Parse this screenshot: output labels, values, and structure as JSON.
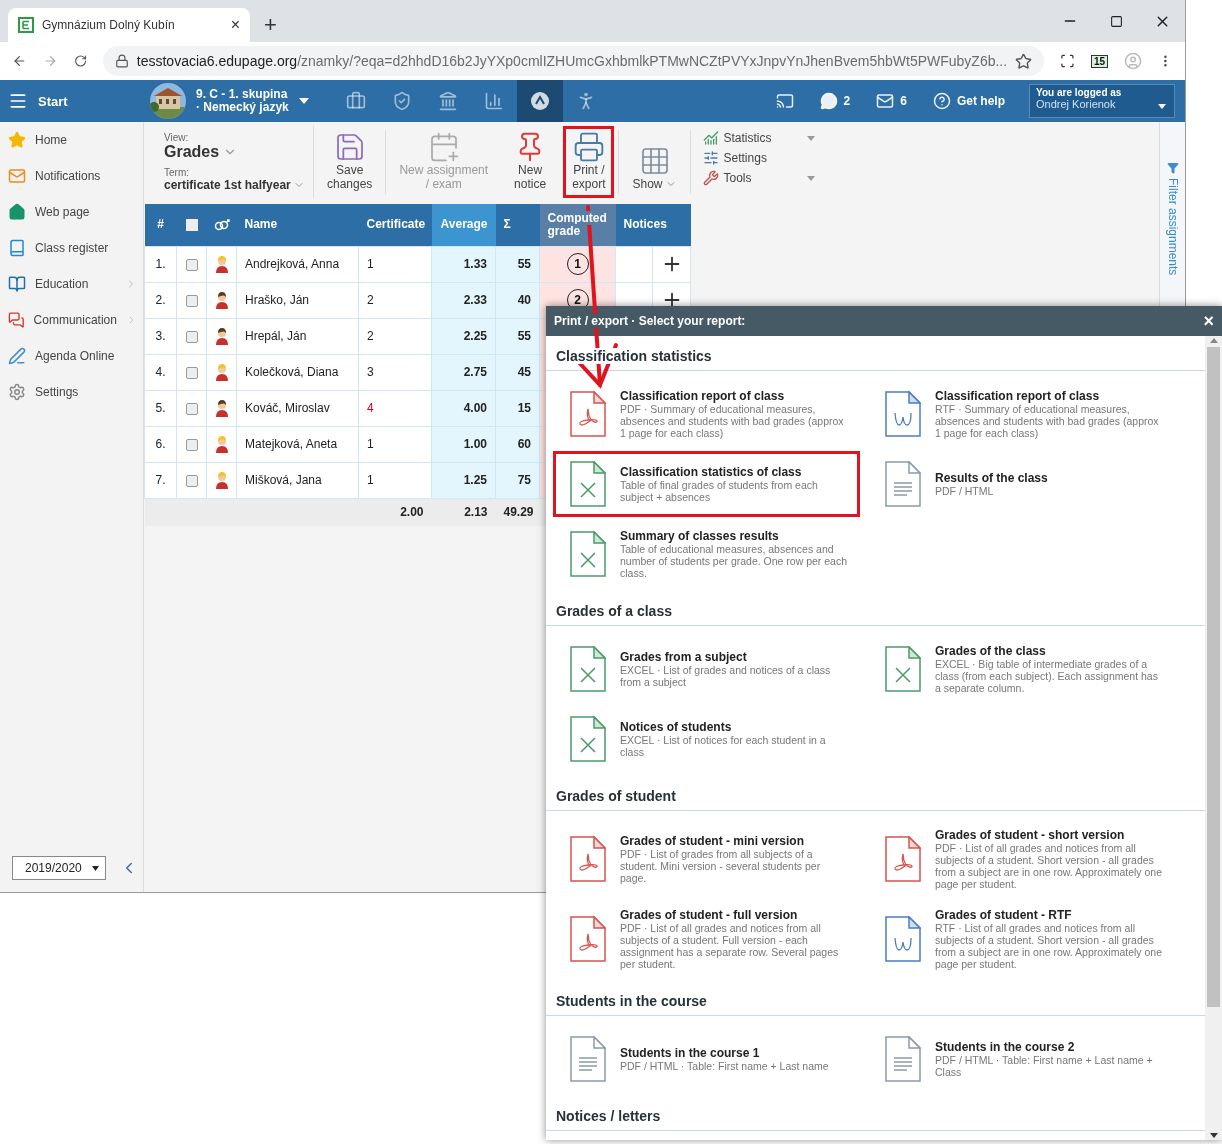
{
  "browser": {
    "tab_title": "Gymnázium Dolný Kubín",
    "tab_close": "×",
    "new_tab": "+",
    "url_domain": "tesstovacia6.edupage.org",
    "url_path": "/znamky/?eqa=d2hhdD16b2JyYXp0cmlIZHUmcGxhbmlkPTMwNCZtPVYxJnpvYnJhenBvem5hbWt5PWFubyZ6b...",
    "calendar_badge": "15"
  },
  "topbar": {
    "start": "Start",
    "class_line1": "9. C - 1. skupina",
    "class_line2": "· Nemecký jazyk",
    "nav": [
      {
        "kind": "briefcase",
        "selected": false
      },
      {
        "kind": "shield",
        "selected": false
      },
      {
        "kind": "bank",
        "selected": false
      },
      {
        "kind": "chart",
        "selected": false
      },
      {
        "kind": "grades",
        "selected": true
      },
      {
        "kind": "walk",
        "selected": false
      }
    ],
    "messages_count": "2",
    "mail_count": "6",
    "help": "Get help",
    "logged_label": "You are logged as",
    "user": "Ondrej Korienok"
  },
  "sidebar": {
    "items": [
      {
        "kind": "home",
        "label": "Home",
        "has_submenu": false
      },
      {
        "kind": "notifications",
        "label": "Notifications",
        "has_submenu": false
      },
      {
        "kind": "web",
        "label": "Web page",
        "has_submenu": false
      },
      {
        "kind": "register",
        "label": "Class register",
        "has_submenu": false
      },
      {
        "kind": "education",
        "label": "Education",
        "has_submenu": true
      },
      {
        "kind": "communication",
        "label": "Communication",
        "has_submenu": true
      },
      {
        "kind": "agenda",
        "label": "Agenda Online",
        "has_submenu": false
      },
      {
        "kind": "settings",
        "label": "Settings",
        "has_submenu": false
      }
    ],
    "year": "2019/2020"
  },
  "toolbar": {
    "view_label": "View:",
    "view_value": "Grades",
    "term_label": "Term:",
    "term_value": "certificate 1st halfyear",
    "buttons": [
      {
        "kind": "save",
        "lines": [
          "Save",
          "changes"
        ],
        "disabled": false,
        "highlighted": false,
        "has_dropdown": false
      },
      {
        "kind": "assignment",
        "lines": [
          "New assignment",
          "/ exam"
        ],
        "disabled": true,
        "highlighted": false,
        "has_dropdown": false
      },
      {
        "kind": "notice",
        "lines": [
          "New",
          "notice"
        ],
        "disabled": false,
        "highlighted": false,
        "has_dropdown": false
      },
      {
        "kind": "print",
        "lines": [
          "Print /",
          "export"
        ],
        "disabled": false,
        "highlighted": true,
        "has_dropdown": false
      },
      {
        "kind": "show",
        "lines": [
          "Show"
        ],
        "disabled": false,
        "highlighted": false,
        "has_dropdown": true
      }
    ],
    "menu": [
      {
        "kind": "statistics",
        "label": "Statistics",
        "has_dropdown": true
      },
      {
        "kind": "settings",
        "label": "Settings",
        "has_dropdown": false
      },
      {
        "kind": "tools",
        "label": "Tools",
        "has_dropdown": true
      }
    ]
  },
  "table": {
    "select_all_checked": false,
    "columns": [
      {
        "kind": "number",
        "label": "#"
      },
      {
        "kind": "select"
      },
      {
        "kind": "gender"
      },
      {
        "kind": "name",
        "label": "Name"
      },
      {
        "kind": "certificate",
        "label": "Certificate"
      },
      {
        "kind": "average",
        "label": "Average"
      },
      {
        "kind": "sum",
        "label": "Σ"
      },
      {
        "kind": "computed",
        "label": "Computed grade"
      },
      {
        "kind": "notices",
        "label": "Notices"
      }
    ],
    "rows": [
      {
        "number": "1.",
        "checked": false,
        "kind": "female",
        "name": "Andrejková, Anna",
        "certificate": "1",
        "failing": false,
        "average": "1.33",
        "sum": "55",
        "computed_grade": "1"
      },
      {
        "number": "2.",
        "checked": false,
        "kind": "male",
        "name": "Hraško, Ján",
        "certificate": "2",
        "failing": false,
        "average": "2.33",
        "sum": "40",
        "computed_grade": "2"
      },
      {
        "number": "3.",
        "checked": false,
        "kind": "male",
        "name": "Hrepál, Ján",
        "certificate": "2",
        "failing": false,
        "average": "2.25",
        "sum": "55"
      },
      {
        "number": "4.",
        "checked": false,
        "kind": "female",
        "name": "Kolečková, Diana",
        "certificate": "3",
        "failing": false,
        "average": "2.75",
        "sum": "45"
      },
      {
        "number": "5.",
        "checked": false,
        "kind": "male",
        "name": "Kováč, Miroslav",
        "certificate": "4",
        "failing": true,
        "average": "4.00",
        "sum": "15"
      },
      {
        "number": "6.",
        "checked": false,
        "kind": "female",
        "name": "Matejková, Aneta",
        "certificate": "1",
        "failing": false,
        "average": "1.00",
        "sum": "60"
      },
      {
        "number": "7.",
        "checked": false,
        "kind": "female",
        "name": "Mišková, Jana",
        "certificate": "1",
        "failing": false,
        "average": "1.25",
        "sum": "75"
      }
    ],
    "footer": {
      "certificate": "2.00",
      "average": "2.13",
      "sum": "49.29"
    }
  },
  "filter_panel": {
    "label": "Filter assignments"
  },
  "dialog": {
    "title": "Print / export · Select your report:",
    "close": "×",
    "sections": [
      {
        "title": "Classification statistics",
        "items": [
          {
            "kind": "pdf",
            "title": "Classification report of class",
            "description": "PDF · Summary of educational measures, absences and students with bad grades (approx 1 page for each class)",
            "highlighted": false
          },
          {
            "kind": "rtf",
            "title": "Classification report of class",
            "description": "RTF · Summary of educational measures, absences and students with bad grades (approx 1 page for each class)",
            "highlighted": false
          },
          {
            "kind": "excel",
            "title": "Classification statistics of class",
            "description": "Table of final grades of students from each subject + absences",
            "highlighted": true
          },
          {
            "kind": "doc",
            "title": "Results of the class",
            "description": "PDF / HTML",
            "highlighted": false
          },
          {
            "kind": "excel",
            "title": "Summary of classes results",
            "description": "Table of educational measures, absences and number of students per grade. One row per each class.",
            "highlighted": false
          }
        ]
      },
      {
        "title": "Grades of a class",
        "items": [
          {
            "kind": "excel",
            "title": "Grades from a subject",
            "description": "EXCEL · List of grades and notices of a class from a subject",
            "highlighted": false
          },
          {
            "kind": "excel",
            "title": "Grades of the class",
            "description": "EXCEL · Big table of intermediate grades of a class (from each subject). Each assignment has a separate column.",
            "highlighted": false
          },
          {
            "kind": "excel",
            "title": "Notices of students",
            "description": "EXCEL · List of notices for each student in a class",
            "highlighted": false
          }
        ]
      },
      {
        "title": "Grades of student",
        "items": [
          {
            "kind": "pdf",
            "title": "Grades of student - mini version",
            "description": "PDF · List of grades from all subjects of a student. Mini version - several students per page.",
            "highlighted": false
          },
          {
            "kind": "pdf",
            "title": "Grades of student - short version",
            "description": "PDF · List of all grades and notices from all subjects of a student. Short version - all grades from a subject are in one row. Approximately one page per student.",
            "highlighted": false
          },
          {
            "kind": "pdf",
            "title": "Grades of student - full version",
            "description": "PDF · List of all grades and notices from all subjects of a student. Full version - each assignment has a separate row. Several pages per student.",
            "highlighted": false
          },
          {
            "kind": "rtf",
            "title": "Grades of student - RTF",
            "description": "RTF · List of all grades and notices from all subjects of a student. Short version - all grades from a subject are in one row. Approximately one page per student.",
            "highlighted": false
          }
        ]
      },
      {
        "title": "Students in the course",
        "items": [
          {
            "kind": "doc",
            "title": "Students in the course 1",
            "description": "PDF / HTML · Table: First name + Last name",
            "highlighted": false
          },
          {
            "kind": "doc",
            "title": "Students in the course 2",
            "description": "PDF / HTML · Table: First name + Last name + Class",
            "highlighted": false
          }
        ]
      },
      {
        "title": "Notices / letters"
      }
    ]
  }
}
